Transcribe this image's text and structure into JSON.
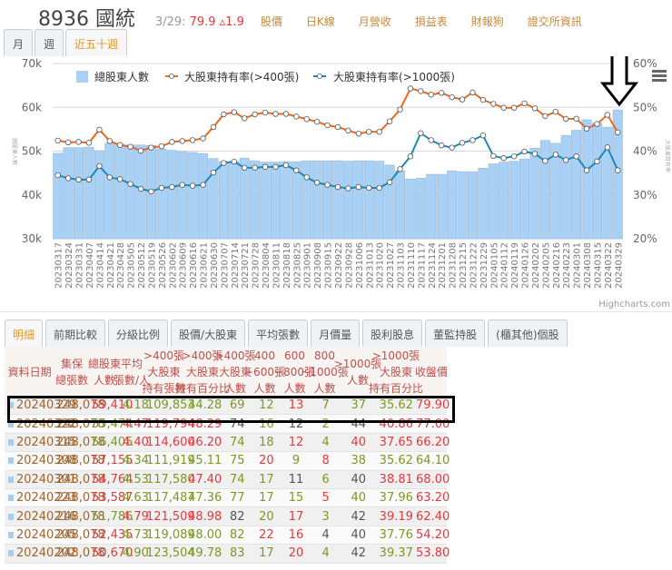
{
  "header": {
    "title": "8936 國統",
    "date": "3/29:",
    "price": "79.9 ▵1.9",
    "links": [
      "股價",
      "日K線",
      "月營收",
      "損益表",
      "財報狗",
      "證交所資訊"
    ]
  },
  "period_tabs": [
    {
      "label": "月",
      "active": false
    },
    {
      "label": "週",
      "active": false
    },
    {
      "label": "近五十週",
      "active": true
    }
  ],
  "chart_data": {
    "type": "bar+line",
    "legend": [
      "總股東人數",
      "大股東持有率(>400張)",
      "大股東持有率(>1000張)"
    ],
    "left_ticks": [
      "70k",
      "60k",
      "50k",
      "40k",
      "30k"
    ],
    "right_ticks": [
      "60%",
      "50%",
      "40%",
      "30%",
      "20%"
    ],
    "ylim_left": [
      30,
      70
    ],
    "ylim_right": [
      20,
      60
    ],
    "left_axis_title": "總股東人數",
    "right_axis_title": "大股東持有率",
    "credit": "Highcharts.com",
    "colors": {
      "bar": "#a9d0f5",
      "orange": "#f0661c",
      "blue": "#1a8bb8"
    },
    "x": [
      "20230317",
      "20230324",
      "20230331",
      "20230407",
      "20230414",
      "20230421",
      "20230428",
      "20230505",
      "20230512",
      "20230519",
      "20230526",
      "20230602",
      "20230609",
      "20230616",
      "20230621",
      "20230630",
      "20230707",
      "20230714",
      "20230721",
      "20230728",
      "20230804",
      "20230811",
      "20230818",
      "20230825",
      "20230901",
      "20230908",
      "20230915",
      "20230922",
      "20230928",
      "20231006",
      "20231013",
      "20231020",
      "20231027",
      "20231103",
      "20231110",
      "20231117",
      "20231124",
      "20231201",
      "20231208",
      "20231215",
      "20231222",
      "20231229",
      "20240105",
      "20240112",
      "20240119",
      "20240126",
      "20240202",
      "20240205",
      "20240216",
      "20240223",
      "20240301",
      "20240308",
      "20240315",
      "20240322",
      "20240329"
    ],
    "holders_k": [
      49.5,
      50.8,
      50.8,
      50.9,
      50.1,
      51.8,
      51.6,
      51.4,
      51.4,
      51.3,
      50.5,
      50.2,
      49.9,
      49.7,
      49.4,
      48.3,
      47.6,
      47.6,
      48.4,
      47.8,
      47.5,
      47.5,
      47.6,
      47.6,
      47.8,
      47.8,
      47.8,
      47.8,
      47.7,
      47.8,
      47.8,
      47.7,
      46.8,
      45.5,
      43.6,
      43.8,
      44.7,
      44.7,
      45.5,
      45.3,
      45.3,
      46.1,
      47.1,
      47.5,
      47.7,
      48.2,
      50.67,
      52.44,
      51.79,
      53.59,
      54.76,
      57.16,
      56.41,
      55.47,
      59.41
    ],
    "pct_400": [
      42.4,
      42.0,
      42.1,
      41.9,
      44.9,
      42.3,
      41.4,
      41.0,
      40.1,
      40.8,
      41.1,
      42.1,
      42.3,
      42.5,
      42.9,
      45.5,
      48.4,
      48.9,
      47.5,
      48.4,
      48.8,
      48.5,
      48.5,
      47.9,
      47.3,
      46.7,
      45.9,
      45.5,
      44.7,
      44.0,
      44.4,
      44.4,
      46.8,
      49.5,
      54.3,
      53.7,
      52.9,
      53.3,
      52.3,
      51.8,
      53.4,
      51.7,
      50.8,
      49.9,
      49.9,
      50.9,
      49.78,
      48.0,
      48.98,
      47.36,
      47.4,
      45.11,
      46.2,
      48.29,
      44.28
    ],
    "pct_1000": [
      34.5,
      33.8,
      33.5,
      33.5,
      36.6,
      34.0,
      33.6,
      32.5,
      31.4,
      30.8,
      31.6,
      31.8,
      32.3,
      32.1,
      32.3,
      35.1,
      37.3,
      37.6,
      36.2,
      36.2,
      36.4,
      36.4,
      36.8,
      35.6,
      34.0,
      32.8,
      32.3,
      31.8,
      31.5,
      31.8,
      31.6,
      31.6,
      32.9,
      35.9,
      38.8,
      44.1,
      42.5,
      41.3,
      40.8,
      41.9,
      42.5,
      43.6,
      38.9,
      38.4,
      38.8,
      39.9,
      39.37,
      37.76,
      39.19,
      37.96,
      38.81,
      35.62,
      37.65,
      40.86,
      35.62
    ]
  },
  "table_tabs": [
    {
      "label": "明細",
      "active": true
    },
    {
      "label": "前期比較"
    },
    {
      "label": "分級比例"
    },
    {
      "label": "股價/大股東"
    },
    {
      "label": "平均張數"
    },
    {
      "label": "月價量"
    },
    {
      "label": "股利股息"
    },
    {
      "label": "董監持股"
    },
    {
      "label": "(櫃其他)個股"
    }
  ],
  "table": {
    "headers": [
      "資料日期",
      "集保\n總張數",
      "總股東\n人數",
      "平均\n張數/人",
      ">400張\n大股東\n持有張數",
      ">400張\n大股東\n持有百分比",
      ">400張\n大股東\n人數",
      "400\n~600張\n人數",
      "600\n~800張\n人數",
      "800\n~1000張\n人數",
      ">1000張\n人數",
      ">1000張\n大股東\n持有百分比",
      "收盤價"
    ],
    "colors": {
      "u": "#e8383d",
      "g": "#7a9a20",
      "n": "#555555",
      "d": "#a0642c",
      "r2": "#b0303a"
    },
    "rows": [
      {
        "cells": [
          "20240329",
          "248,078",
          "59,410",
          "4.18",
          "109,853",
          "44.28",
          "69",
          "12",
          "13",
          "7",
          "37",
          "35.62",
          "79.90"
        ],
        "c": "ddugggggugggu"
      },
      {
        "cells": [
          "20240322",
          "248,078",
          "55,474",
          "4.47",
          "119,794",
          "48.29",
          "74",
          "16",
          "12",
          "2",
          "44",
          "40.86",
          "77.00"
        ],
        "c": "ddguuungngnuu"
      },
      {
        "cells": [
          "20240315",
          "248,078",
          "56,405",
          "4.40",
          "114,600",
          "46.20",
          "74",
          "18",
          "12",
          "4",
          "40",
          "37.65",
          "66.20"
        ],
        "c": "ddguuugguguuu"
      },
      {
        "cells": [
          "20240308",
          "248,078",
          "57,155",
          "4.34",
          "111,919",
          "45.11",
          "75",
          "20",
          "9",
          "8",
          "38",
          "35.62",
          "64.10"
        ],
        "c": "ddugggguguggg"
      },
      {
        "cells": [
          "20240301",
          "248,078",
          "54,764",
          "4.53",
          "117,580",
          "47.40",
          "74",
          "17",
          "11",
          "6",
          "40",
          "38.81",
          "68.00"
        ],
        "c": "ddugguggngnuu"
      },
      {
        "cells": [
          "20240223",
          "248,078",
          "53,587",
          "4.63",
          "117,487",
          "47.36",
          "77",
          "17",
          "15",
          "5",
          "40",
          "37.96",
          "63.20"
        ],
        "c": "ddugggggguggu"
      },
      {
        "cells": [
          "20240216",
          "248,078",
          "51,786",
          "4.79",
          "121,509",
          "48.98",
          "82",
          "20",
          "17",
          "3",
          "42",
          "39.19",
          "62.40"
        ],
        "c": "ddguuungugauu"
      },
      {
        "cells": [
          "20240205",
          "248,078",
          "52,435",
          "4.73",
          "119,089",
          "48.00",
          "82",
          "22",
          "16",
          "4",
          "40",
          "37.76",
          "54.20"
        ],
        "c": "ddugggguunngu"
      },
      {
        "cells": [
          "20240202",
          "248,078",
          "50,670",
          "4.90",
          "123,504",
          "49.78",
          "83",
          "17",
          "20",
          "4",
          "42",
          "39.37",
          "53.80"
        ],
        "c": "ddugggggugngu"
      }
    ]
  }
}
